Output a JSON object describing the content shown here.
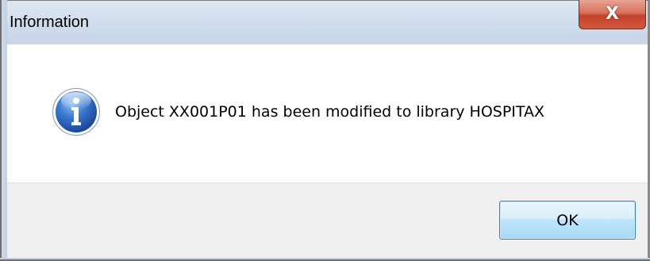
{
  "window": {
    "title": "Information",
    "close_glyph": "X",
    "close_icon": "close-icon"
  },
  "message": {
    "icon": "info-icon",
    "text": "Object XX001P01 has been modified to library HOSPITAX"
  },
  "buttons": {
    "ok_label": "OK"
  },
  "colors": {
    "titlebar": "#cfdcec",
    "close_button": "#c4412b",
    "footer": "#f0f0f0",
    "info_icon": "#2b5fb3",
    "ok_button_border": "#3c7fb1"
  }
}
